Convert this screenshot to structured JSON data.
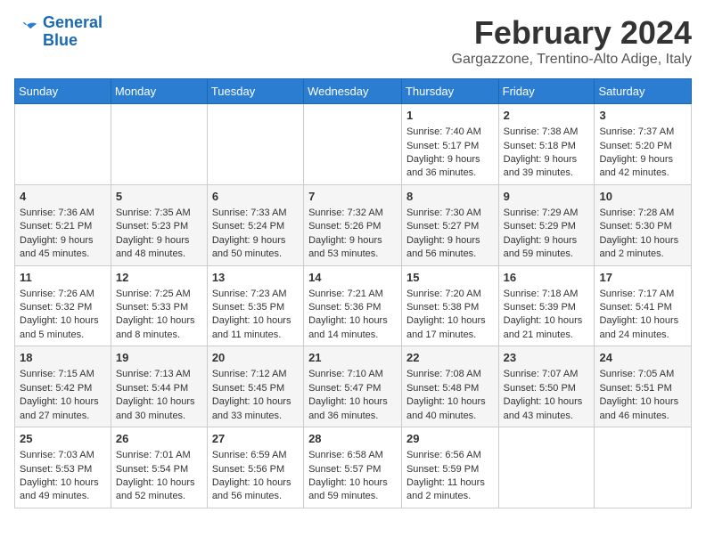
{
  "header": {
    "logo_line1": "General",
    "logo_line2": "Blue",
    "month_title": "February 2024",
    "subtitle": "Gargazzone, Trentino-Alto Adige, Italy"
  },
  "days_of_week": [
    "Sunday",
    "Monday",
    "Tuesday",
    "Wednesday",
    "Thursday",
    "Friday",
    "Saturday"
  ],
  "weeks": [
    [
      {
        "day": "",
        "content": ""
      },
      {
        "day": "",
        "content": ""
      },
      {
        "day": "",
        "content": ""
      },
      {
        "day": "",
        "content": ""
      },
      {
        "day": "1",
        "content": "Sunrise: 7:40 AM\nSunset: 5:17 PM\nDaylight: 9 hours\nand 36 minutes."
      },
      {
        "day": "2",
        "content": "Sunrise: 7:38 AM\nSunset: 5:18 PM\nDaylight: 9 hours\nand 39 minutes."
      },
      {
        "day": "3",
        "content": "Sunrise: 7:37 AM\nSunset: 5:20 PM\nDaylight: 9 hours\nand 42 minutes."
      }
    ],
    [
      {
        "day": "4",
        "content": "Sunrise: 7:36 AM\nSunset: 5:21 PM\nDaylight: 9 hours\nand 45 minutes."
      },
      {
        "day": "5",
        "content": "Sunrise: 7:35 AM\nSunset: 5:23 PM\nDaylight: 9 hours\nand 48 minutes."
      },
      {
        "day": "6",
        "content": "Sunrise: 7:33 AM\nSunset: 5:24 PM\nDaylight: 9 hours\nand 50 minutes."
      },
      {
        "day": "7",
        "content": "Sunrise: 7:32 AM\nSunset: 5:26 PM\nDaylight: 9 hours\nand 53 minutes."
      },
      {
        "day": "8",
        "content": "Sunrise: 7:30 AM\nSunset: 5:27 PM\nDaylight: 9 hours\nand 56 minutes."
      },
      {
        "day": "9",
        "content": "Sunrise: 7:29 AM\nSunset: 5:29 PM\nDaylight: 9 hours\nand 59 minutes."
      },
      {
        "day": "10",
        "content": "Sunrise: 7:28 AM\nSunset: 5:30 PM\nDaylight: 10 hours\nand 2 minutes."
      }
    ],
    [
      {
        "day": "11",
        "content": "Sunrise: 7:26 AM\nSunset: 5:32 PM\nDaylight: 10 hours\nand 5 minutes."
      },
      {
        "day": "12",
        "content": "Sunrise: 7:25 AM\nSunset: 5:33 PM\nDaylight: 10 hours\nand 8 minutes."
      },
      {
        "day": "13",
        "content": "Sunrise: 7:23 AM\nSunset: 5:35 PM\nDaylight: 10 hours\nand 11 minutes."
      },
      {
        "day": "14",
        "content": "Sunrise: 7:21 AM\nSunset: 5:36 PM\nDaylight: 10 hours\nand 14 minutes."
      },
      {
        "day": "15",
        "content": "Sunrise: 7:20 AM\nSunset: 5:38 PM\nDaylight: 10 hours\nand 17 minutes."
      },
      {
        "day": "16",
        "content": "Sunrise: 7:18 AM\nSunset: 5:39 PM\nDaylight: 10 hours\nand 21 minutes."
      },
      {
        "day": "17",
        "content": "Sunrise: 7:17 AM\nSunset: 5:41 PM\nDaylight: 10 hours\nand 24 minutes."
      }
    ],
    [
      {
        "day": "18",
        "content": "Sunrise: 7:15 AM\nSunset: 5:42 PM\nDaylight: 10 hours\nand 27 minutes."
      },
      {
        "day": "19",
        "content": "Sunrise: 7:13 AM\nSunset: 5:44 PM\nDaylight: 10 hours\nand 30 minutes."
      },
      {
        "day": "20",
        "content": "Sunrise: 7:12 AM\nSunset: 5:45 PM\nDaylight: 10 hours\nand 33 minutes."
      },
      {
        "day": "21",
        "content": "Sunrise: 7:10 AM\nSunset: 5:47 PM\nDaylight: 10 hours\nand 36 minutes."
      },
      {
        "day": "22",
        "content": "Sunrise: 7:08 AM\nSunset: 5:48 PM\nDaylight: 10 hours\nand 40 minutes."
      },
      {
        "day": "23",
        "content": "Sunrise: 7:07 AM\nSunset: 5:50 PM\nDaylight: 10 hours\nand 43 minutes."
      },
      {
        "day": "24",
        "content": "Sunrise: 7:05 AM\nSunset: 5:51 PM\nDaylight: 10 hours\nand 46 minutes."
      }
    ],
    [
      {
        "day": "25",
        "content": "Sunrise: 7:03 AM\nSunset: 5:53 PM\nDaylight: 10 hours\nand 49 minutes."
      },
      {
        "day": "26",
        "content": "Sunrise: 7:01 AM\nSunset: 5:54 PM\nDaylight: 10 hours\nand 52 minutes."
      },
      {
        "day": "27",
        "content": "Sunrise: 6:59 AM\nSunset: 5:56 PM\nDaylight: 10 hours\nand 56 minutes."
      },
      {
        "day": "28",
        "content": "Sunrise: 6:58 AM\nSunset: 5:57 PM\nDaylight: 10 hours\nand 59 minutes."
      },
      {
        "day": "29",
        "content": "Sunrise: 6:56 AM\nSunset: 5:59 PM\nDaylight: 11 hours\nand 2 minutes."
      },
      {
        "day": "",
        "content": ""
      },
      {
        "day": "",
        "content": ""
      }
    ]
  ]
}
